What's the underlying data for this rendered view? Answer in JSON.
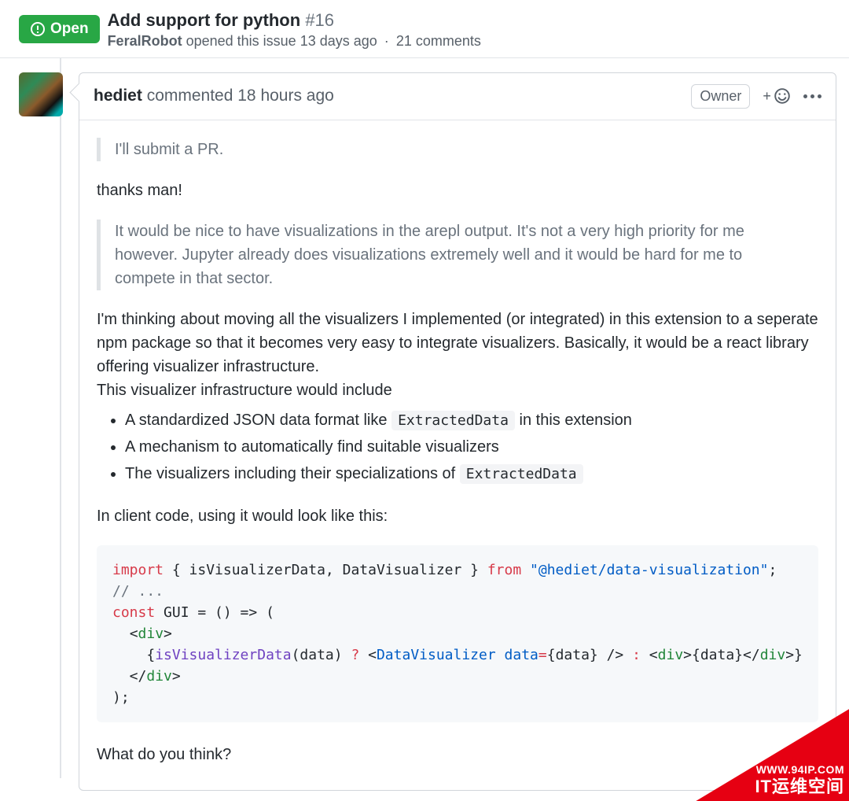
{
  "issue": {
    "state_label": "Open",
    "title": "Add support for python",
    "number": "#16",
    "author": "FeralRobot",
    "opened_rel": "opened this issue 13 days ago",
    "comments_count": "21 comments"
  },
  "comment": {
    "author": "hediet",
    "verb": "commented",
    "time_rel": "18 hours ago",
    "role": "Owner",
    "quote1": "I'll submit a PR.",
    "reply1": "thanks man!",
    "quote2": "It would be nice to have visualizations in the arepl output. It's not a very high priority for me however. Jupyter already does visualizations extremely well and it would be hard for me to compete in that sector.",
    "para2a": "I'm thinking about moving all the visualizers I implemented (or integrated) in this extension to a seperate npm package so that it becomes very easy to integrate visualizers. Basically, it would be a react library offering visualizer infrastructure.",
    "para2b": "This visualizer infrastructure would include",
    "bullets": {
      "b1_pre": "A standardized JSON data format like ",
      "b1_code": "ExtractedData",
      "b1_post": " in this extension",
      "b2": "A mechanism to automatically find suitable visualizers",
      "b3_pre": "The visualizers including their specializations of ",
      "b3_code": "ExtractedData"
    },
    "para3": "In client code, using it would look like this:",
    "closing": "What do you think?"
  },
  "code": {
    "kw_import": "import",
    "imports": " { isVisualizerData, DataVisualizer } ",
    "kw_from": "from",
    "pkg": "\"@hediet/data-visualization\"",
    "semi": ";",
    "comment_line": "// ...",
    "kw_const": "const",
    "gui_decl": " GUI = () => (",
    "open_div_lt": "<",
    "tag_div": "div",
    "gt": ">",
    "brace_open": "    {",
    "fn_isvis": "isVisualizerData",
    "fn_args": "(data) ",
    "qmark": "?",
    "sp_lt": " <",
    "comp_datavis": "DataVisualizer",
    "sp": " ",
    "attr_data": "data",
    "eq": "=",
    "attr_val": "{data} /> ",
    "colon": ":",
    "child_text": ">{data}</",
    "brace_close": ">}",
    "close_div_lt": "  </",
    "tail": ");"
  },
  "watermark": {
    "line1": "WWW.94IP.COM",
    "line2": "IT运维空间"
  }
}
